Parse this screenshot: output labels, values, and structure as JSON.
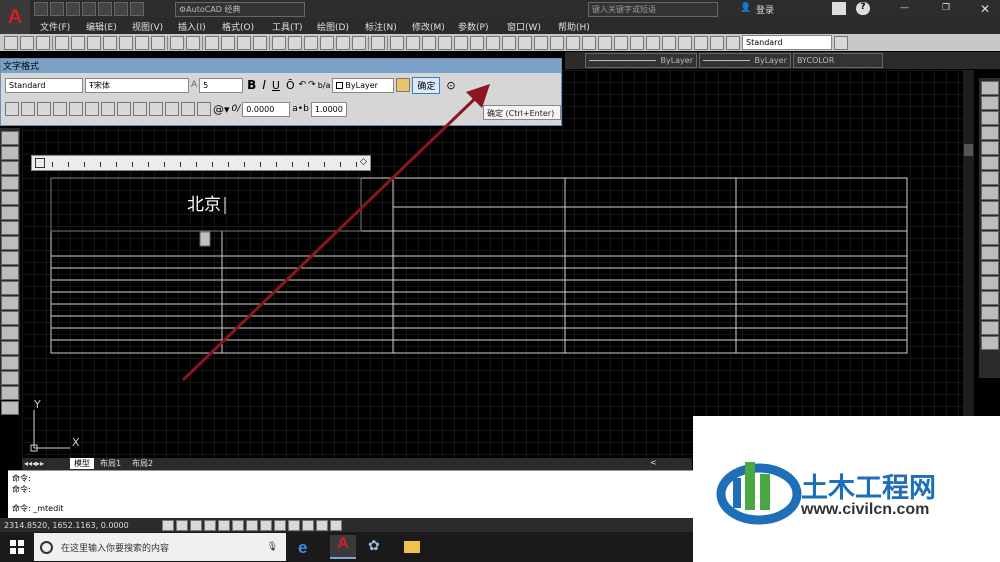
{
  "app": {
    "workspace": "AutoCAD 经典",
    "search_placeholder": "键入关键字或短语",
    "login": "登录",
    "help": "?"
  },
  "menu": [
    "文件(F)",
    "编辑(E)",
    "视图(V)",
    "插入(I)",
    "格式(O)",
    "工具(T)",
    "绘图(D)",
    "标注(N)",
    "修改(M)",
    "参数(P)",
    "窗口(W)",
    "帮助(H)"
  ],
  "properties": {
    "style": "Standard",
    "linetype1": "ByLayer",
    "linetype2": "ByLayer",
    "color": "BYCOLOR"
  },
  "text_format": {
    "title": "文字格式",
    "style": "Standard",
    "font": "宋体",
    "height": "5",
    "bold": "B",
    "italic": "I",
    "underline": "U",
    "overline": "Ō",
    "color": "ByLayer",
    "ok": "确定",
    "ok_tooltip": "确定 (Ctrl+Enter)",
    "oblique": "0.0000",
    "tracking": "1.0000"
  },
  "canvas": {
    "cell_text": "北京",
    "axis_y": "Y",
    "axis_x": "X"
  },
  "layout_tabs": [
    "模型",
    "布局1",
    "布局2"
  ],
  "command": {
    "lines": [
      "命令:",
      "命令:"
    ],
    "current": "命令:  _mtedit"
  },
  "status": {
    "coords": "2314.8520,  1652.1163,  0.0000"
  },
  "taskbar": {
    "search": "在这里输入你要搜索的内容"
  },
  "watermark": {
    "name": "土木工程网",
    "url": "www.civilcn.com"
  },
  "colors": {
    "arrow": "#8b1520",
    "logo_blue": "#1f6fb8",
    "logo_green": "#4aa843"
  }
}
